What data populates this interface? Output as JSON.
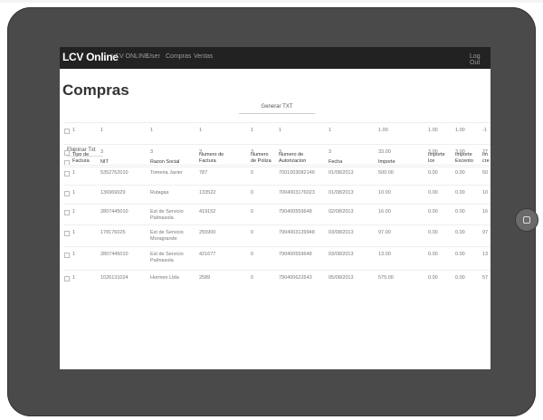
{
  "navbar": {
    "brand": "LCV Online",
    "items": [
      "LCV ONLINE",
      "User",
      "Compras",
      "Ventas"
    ],
    "logout": "Log Out"
  },
  "page": {
    "title": "Compras",
    "generate_label": "Generar TXT",
    "delete_label": "Eliminar Txt"
  },
  "table": {
    "headers": [
      [
        "Tipo de",
        "Factura"
      ],
      [
        "NIT"
      ],
      [
        "Razon Social"
      ],
      [
        "Numero de",
        "Factura"
      ],
      [
        "Numero",
        "de Poliza"
      ],
      [
        "Numero de",
        "Autorizacion"
      ],
      [
        "Fecha"
      ],
      [
        "Importe"
      ],
      [
        "Importe",
        "Ice"
      ],
      [
        "Importe",
        "Excento"
      ],
      [
        "Im",
        "cre"
      ]
    ],
    "rows": [
      [
        "1",
        "1",
        "1",
        "1",
        "1",
        "1",
        "1",
        "1.00",
        "1.00",
        "1.00",
        "-1"
      ],
      [
        "3",
        "3",
        "3",
        "3",
        "3",
        "3",
        "3",
        "33.00",
        "3.00",
        "3.00",
        "27"
      ],
      [
        "1",
        "5352762010",
        "Tomeria Javier",
        "787",
        "0",
        "7001003082146",
        "01/08/2013",
        "500.00",
        "0.00",
        "0.00",
        "50"
      ],
      [
        "1",
        "136969029",
        "Rutagas",
        "133522",
        "0",
        "7004003176023",
        "01/08/2013",
        "10.00",
        "0.00",
        "0.00",
        "10"
      ],
      [
        "1",
        "2807445010",
        "Est de Servicio Palmasola",
        "419152",
        "0",
        "790400559648",
        "02/08/2013",
        "16.00",
        "0.00",
        "0.00",
        "16"
      ],
      [
        "1",
        "178176025",
        "Est de Servicio Moragrande",
        "255900",
        "0",
        "7904003139948",
        "03/08/2013",
        "97.00",
        "0.00",
        "0.00",
        "97"
      ],
      [
        "1",
        "2807445010",
        "Est de Servicio Palmasola",
        "421677",
        "0",
        "790400559648",
        "03/08/2013",
        "13.00",
        "0.00",
        "0.00",
        "13"
      ],
      [
        "1",
        "1026131024",
        "Hormen Ltda",
        "2589",
        "0",
        "790400622643",
        "05/08/2013",
        "575.00",
        "0.00",
        "0.00",
        "57"
      ]
    ]
  }
}
